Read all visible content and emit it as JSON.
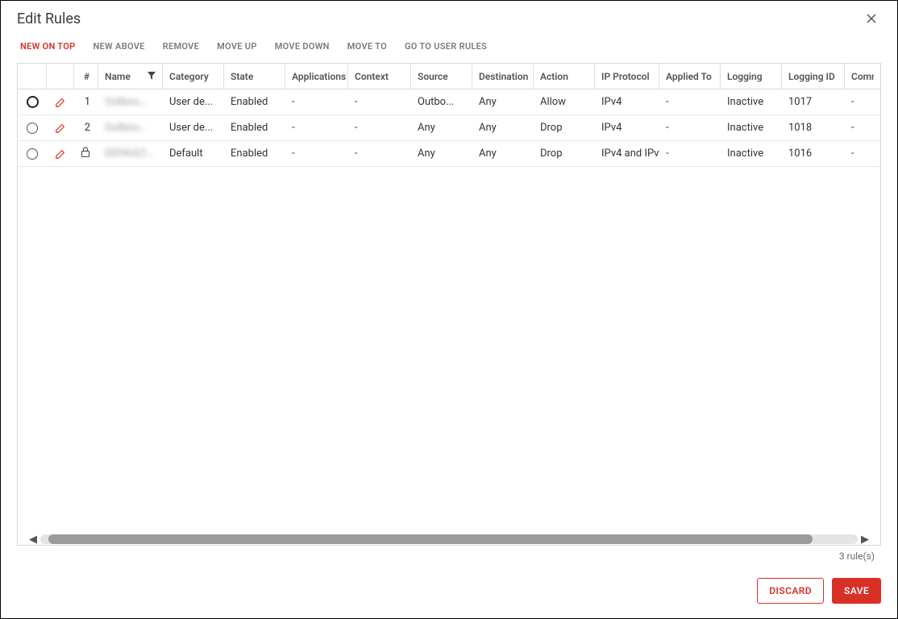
{
  "dialog": {
    "title": "Edit Rules"
  },
  "toolbar": {
    "new_on_top": "NEW ON TOP",
    "new_above": "NEW ABOVE",
    "remove": "REMOVE",
    "move_up": "MOVE UP",
    "move_down": "MOVE DOWN",
    "move_to": "MOVE TO",
    "go_to_user_rules": "GO TO USER RULES"
  },
  "columns": {
    "seq": "#",
    "name": "Name",
    "category": "Category",
    "state": "State",
    "applications": "Applications",
    "context": "Context",
    "source": "Source",
    "destination": "Destination",
    "action": "Action",
    "ip_protocol": "IP Protocol",
    "applied_to": "Applied To",
    "logging": "Logging",
    "logging_id": "Logging ID",
    "comments": "Comm"
  },
  "rows": [
    {
      "seq": "1",
      "name": "Outbou...",
      "locked": false,
      "selected_bold": true,
      "category": "User de...",
      "state": "Enabled",
      "applications": "-",
      "context": "-",
      "source": "Outbo...",
      "destination": "Any",
      "action": "Allow",
      "ip_protocol": "IPv4",
      "applied_to": "-",
      "logging": "Inactive",
      "logging_id": "1017",
      "comments": "-"
    },
    {
      "seq": "2",
      "name": "Outbou...",
      "locked": false,
      "selected_bold": false,
      "category": "User de...",
      "state": "Enabled",
      "applications": "-",
      "context": "-",
      "source": "Any",
      "destination": "Any",
      "action": "Drop",
      "ip_protocol": "IPv4",
      "applied_to": "-",
      "logging": "Inactive",
      "logging_id": "1018",
      "comments": "-"
    },
    {
      "seq": "",
      "name": "DEFAULT...",
      "locked": true,
      "selected_bold": false,
      "category": "Default",
      "state": "Enabled",
      "applications": "-",
      "context": "-",
      "source": "Any",
      "destination": "Any",
      "action": "Drop",
      "ip_protocol": "IPv4 and IPv",
      "applied_to": "-",
      "logging": "Inactive",
      "logging_id": "1016",
      "comments": "-"
    }
  ],
  "footer": {
    "count_text": "3 rule(s)"
  },
  "actions": {
    "discard": "DISCARD",
    "save": "SAVE"
  }
}
